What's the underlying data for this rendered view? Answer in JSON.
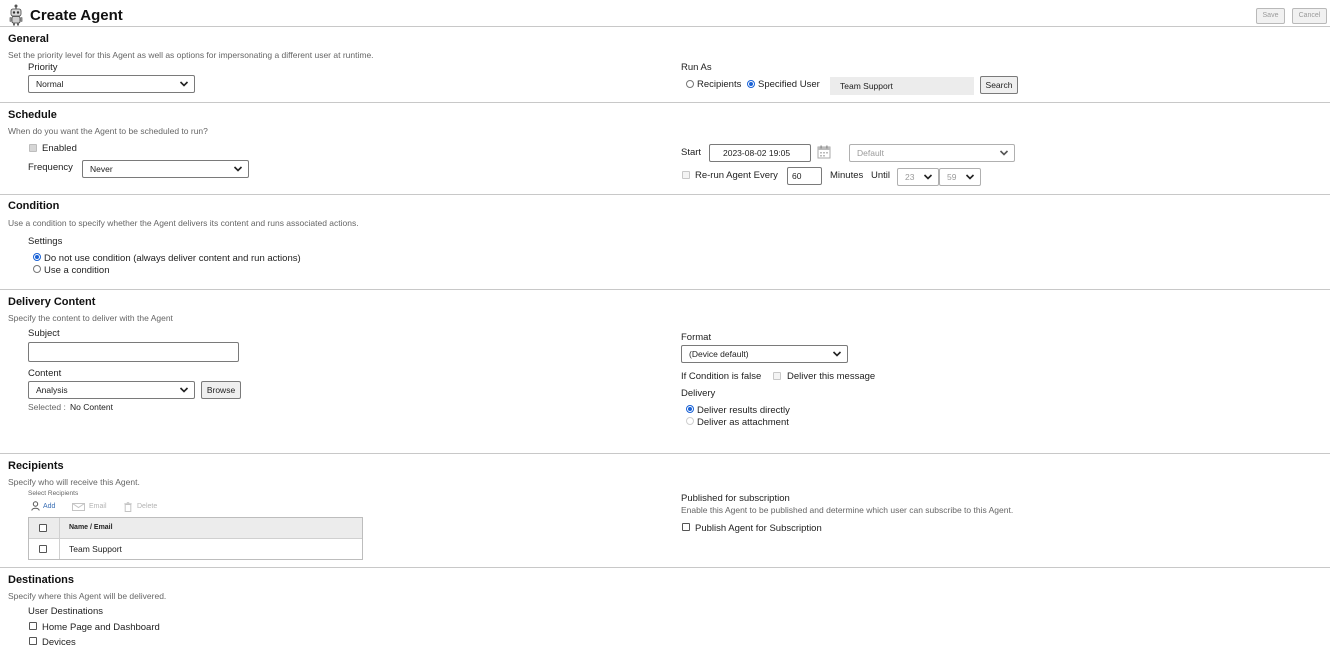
{
  "header": {
    "title": "Create Agent",
    "save_label": "Save",
    "cancel_label": "Cancel"
  },
  "general": {
    "title": "General",
    "description": "Set the priority level for this Agent as well as options for impersonating a different user at runtime.",
    "priority_label": "Priority",
    "priority_value": "Normal",
    "run_as_label": "Run As",
    "run_as_options": [
      "Recipients",
      "Specified User"
    ],
    "run_as_selected": "Specified User",
    "user_value": "Team Support",
    "search_label": "Search"
  },
  "schedule": {
    "title": "Schedule",
    "description": "When do you want the Agent to be scheduled to run?",
    "enabled_label": "Enabled",
    "frequency_label": "Frequency",
    "frequency_value": "Never",
    "start_label": "Start",
    "start_value": "2023-08-02 19:05",
    "timezone_value": "Default",
    "rerun_label": "Re-run Agent Every",
    "rerun_value": "60",
    "minutes_label": "Minutes",
    "until_label": "Until",
    "until_hour": "23",
    "until_minute": "59"
  },
  "condition": {
    "title": "Condition",
    "description": "Use a condition to specify whether the Agent delivers its content and runs associated actions.",
    "settings_label": "Settings",
    "option_none": "Do not use condition (always deliver content and run actions)",
    "option_use": "Use a condition"
  },
  "delivery_content": {
    "title": "Delivery Content",
    "description": "Specify the content to deliver with the Agent",
    "subject_label": "Subject",
    "subject_value": "",
    "content_label": "Content",
    "content_value": "Analysis",
    "browse_label": "Browse",
    "selected_label": "Selected :",
    "selected_value": "No Content",
    "format_label": "Format",
    "format_value": "(Device default)",
    "if_condition_label": "If Condition is false",
    "deliver_message_label": "Deliver this message",
    "delivery_label": "Delivery",
    "delivery_directly": "Deliver results directly",
    "delivery_attachment": "Deliver as attachment"
  },
  "recipients": {
    "title": "Recipients",
    "description": "Specify who will receive this Agent.",
    "select_label": "Select Recipients",
    "add_label": "Add",
    "email_label": "Email",
    "delete_label": "Delete",
    "column_name": "Name / Email",
    "rows": [
      "Team Support"
    ],
    "published_title": "Published for subscription",
    "published_description": "Enable this Agent to be published and determine which user can subscribe to this Agent.",
    "publish_label": "Publish Agent for Subscription"
  },
  "destinations": {
    "title": "Destinations",
    "description": "Specify where this Agent will be delivered.",
    "user_destinations_label": "User Destinations",
    "home_page_label": "Home Page and Dashboard",
    "devices_label": "Devices"
  },
  "colors": {
    "accent": "#1a62d6",
    "divider": "#c8c8c8",
    "muted": "#666666"
  }
}
